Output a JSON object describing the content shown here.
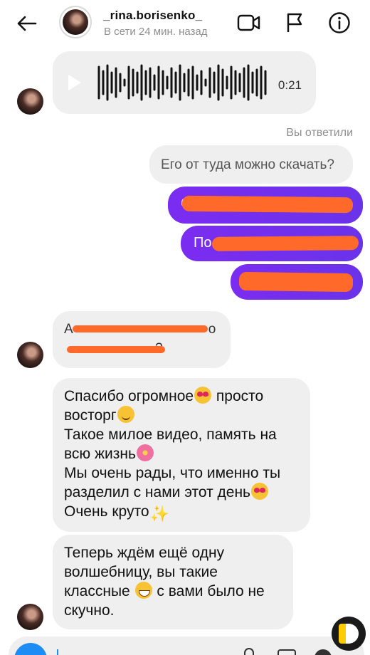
{
  "header": {
    "username": "_rina.borisenko_",
    "status": "В сети 24 мин. назад",
    "icons": [
      "back-arrow-icon",
      "video-camera-icon",
      "flag-icon",
      "info-icon"
    ]
  },
  "thread": {
    "voice_message": {
      "duration": "0:21"
    },
    "reply_label": "Вы ответили",
    "question": "Его от туда можно скачать?",
    "outgoing_redacted": [
      {
        "visible_start": "С",
        "visible_end": ""
      },
      {
        "visible_start": "По",
        "visible_end": "?"
      },
      {
        "visible_start": "",
        "visible_end": ""
      }
    ],
    "incoming_redacted": {
      "line1_start": "А",
      "line1_end": "о",
      "line2_end": "?"
    },
    "message_thanks": {
      "line1": "Спасибо огромное",
      "line1b": " просто",
      "line2": "восторг",
      "line3": "Такое милое видео, память на",
      "line4": "всю жизнь",
      "line5": "Мы очень рады, что именно ты",
      "line6": "разделил с нами этот день",
      "line7": "Очень круто"
    },
    "message_wait": {
      "line1": "Теперь ждём ещё одну",
      "line2": "волшебницу, вы такие",
      "line3a": "классные ",
      "line3b": " с вами было не",
      "line4": "скучно."
    }
  },
  "colors": {
    "outgoing_bubble": "#7b2cf0",
    "incoming_bubble": "#efefef",
    "redaction": "#ff6a2a",
    "muted_text": "#8e8e8e"
  }
}
